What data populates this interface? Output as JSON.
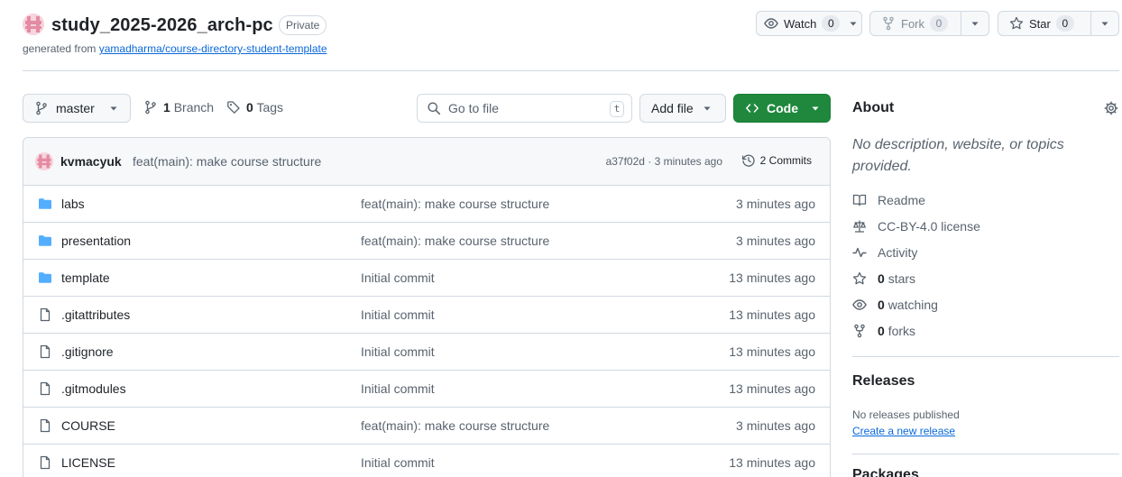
{
  "repo": {
    "name": "study_2025-2026_arch-pc",
    "visibility": "Private",
    "generated_prefix": "generated from",
    "template_link": "yamadharma/course-directory-student-template"
  },
  "actions": {
    "watch_label": "Watch",
    "watch_count": "0",
    "fork_label": "Fork",
    "fork_count": "0",
    "star_label": "Star",
    "star_count": "0"
  },
  "toolbar": {
    "branch": "master",
    "branches_count": "1",
    "branches_label": "Branch",
    "tags_count": "0",
    "tags_label": "Tags",
    "search_placeholder": "Go to file",
    "search_shortcut": "t",
    "add_file": "Add file",
    "code": "Code"
  },
  "latest_commit": {
    "author": "kvmacyuk",
    "message": "feat(main): make course structure",
    "sha_time": "a37f02d · 3 minutes ago",
    "commits_label": "2 Commits"
  },
  "files": [
    {
      "name": "labs",
      "type": "folder",
      "commit": "feat(main): make course structure",
      "time": "3 minutes ago"
    },
    {
      "name": "presentation",
      "type": "folder",
      "commit": "feat(main): make course structure",
      "time": "3 minutes ago"
    },
    {
      "name": "template",
      "type": "folder",
      "commit": "Initial commit",
      "time": "13 minutes ago"
    },
    {
      "name": ".gitattributes",
      "type": "file",
      "commit": "Initial commit",
      "time": "13 minutes ago"
    },
    {
      "name": ".gitignore",
      "type": "file",
      "commit": "Initial commit",
      "time": "13 minutes ago"
    },
    {
      "name": ".gitmodules",
      "type": "file",
      "commit": "Initial commit",
      "time": "13 minutes ago"
    },
    {
      "name": "COURSE",
      "type": "file",
      "commit": "feat(main): make course structure",
      "time": "3 minutes ago"
    },
    {
      "name": "LICENSE",
      "type": "file",
      "commit": "Initial commit",
      "time": "13 minutes ago"
    }
  ],
  "about": {
    "title": "About",
    "description": "No description, website, or topics provided.",
    "readme": "Readme",
    "license": "CC-BY-4.0 license",
    "activity": "Activity",
    "stars_count": "0",
    "stars_label": "stars",
    "watching_count": "0",
    "watching_label": "watching",
    "forks_count": "0",
    "forks_label": "forks"
  },
  "releases": {
    "title": "Releases",
    "none": "No releases published",
    "create": "Create a new release"
  },
  "packages": {
    "title": "Packages"
  },
  "colors": {
    "accent": "#0969da",
    "primary_button": "#1f883d",
    "folder_icon": "#54aeff",
    "muted_text": "#59636e",
    "border": "#d1d9e0"
  }
}
